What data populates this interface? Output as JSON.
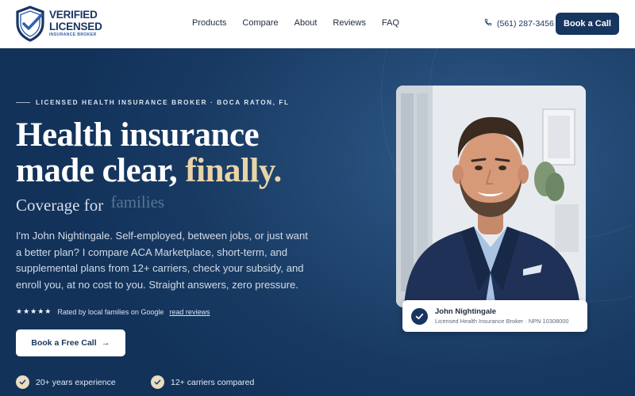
{
  "brand": {
    "line1": "VERIFIED",
    "line2": "LICENSED",
    "line3": "INSURANCE BROKER",
    "logo_icon": "shield-check-icon"
  },
  "nav": {
    "items": [
      {
        "label": "Products"
      },
      {
        "label": "Compare"
      },
      {
        "label": "About"
      },
      {
        "label": "Reviews"
      },
      {
        "label": "FAQ"
      }
    ]
  },
  "header": {
    "phone": "(561) 287-3456",
    "phone_icon": "phone-icon",
    "book_label": "Book a Call"
  },
  "hero": {
    "eyebrow": "LICENSED HEALTH INSURANCE BROKER · BOCA RATON, FL",
    "headline_1": "Health insurance",
    "headline_2": "made clear,",
    "headline_accent": "finally.",
    "coverage_prefix": "Coverage for",
    "coverage_word": "families",
    "description": "I'm John Nightingale. Self-employed, between jobs, or just want a better plan? I compare ACA Marketplace, short-term, and supplemental plans from 12+ carriers, check your subsidy, and enroll you, at no cost to you. Straight answers, zero pressure.",
    "stars": "★★★★★",
    "rating_text": "Rated by local families on Google",
    "reviews_link": "read reviews",
    "cta_label": "Book a Free Call",
    "cta_arrow": "→",
    "features": [
      {
        "label": "20+ years experience"
      },
      {
        "label": "12+ carriers compared"
      }
    ]
  },
  "profile": {
    "name": "John Nightingale",
    "subtitle": "Licensed Health Insurance Broker · NPN 10308000"
  },
  "colors": {
    "navy": "#17365f",
    "accent_gold": "#e9d4a8",
    "hero_bg": "#1b3d66"
  }
}
